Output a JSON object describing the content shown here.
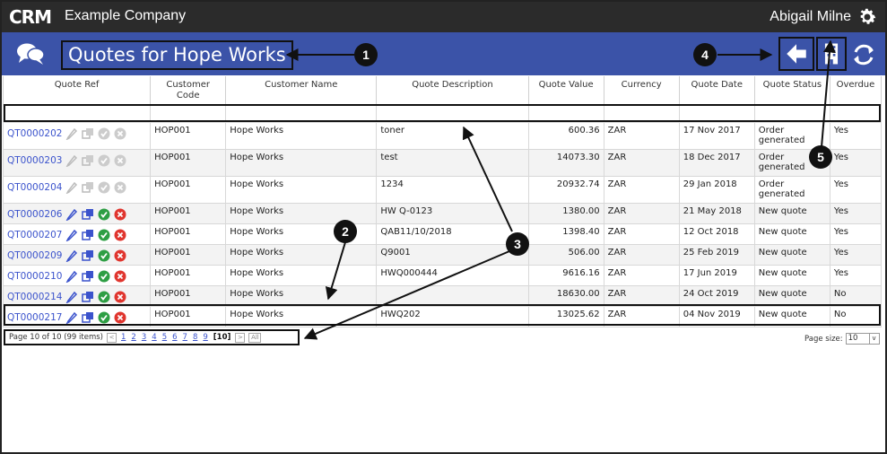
{
  "app": {
    "logo": "CRM",
    "company": "Example Company",
    "user": "Abigail Milne"
  },
  "header": {
    "title": "Quotes for Hope Works"
  },
  "icons": {
    "chat": "chat-bubbles-icon",
    "back": "arrow-left-icon",
    "company": "building-icon",
    "refresh": "refresh-icon",
    "settings": "gear-icon"
  },
  "colors": {
    "topbar": "#2b2b2b",
    "subbar": "#3b53a8",
    "link": "#3b53cc",
    "ok": "#2e9e44",
    "cancel": "#e0352e"
  },
  "columns": [
    "Quote Ref",
    "Customer Code",
    "Customer Name",
    "Quote Description",
    "Quote Value",
    "Currency",
    "Quote Date",
    "Quote Status",
    "Overdue"
  ],
  "rows": [
    {
      "ref": "QT0000202",
      "code": "HOP001",
      "name": "Hope Works",
      "desc": "toner",
      "value": "600.36",
      "currency": "ZAR",
      "date": "17 Nov 2017",
      "status": "Order generated",
      "overdue": "Yes"
    },
    {
      "ref": "QT0000203",
      "code": "HOP001",
      "name": "Hope Works",
      "desc": "test",
      "value": "14073.30",
      "currency": "ZAR",
      "date": "18 Dec 2017",
      "status": "Order generated",
      "overdue": "Yes"
    },
    {
      "ref": "QT0000204",
      "code": "HOP001",
      "name": "Hope Works",
      "desc": "1234",
      "value": "20932.74",
      "currency": "ZAR",
      "date": "29 Jan 2018",
      "status": "Order generated",
      "overdue": "Yes"
    },
    {
      "ref": "QT0000206",
      "code": "HOP001",
      "name": "Hope Works",
      "desc": "HW Q-0123",
      "value": "1380.00",
      "currency": "ZAR",
      "date": "21 May 2018",
      "status": "New quote",
      "overdue": "Yes"
    },
    {
      "ref": "QT0000207",
      "code": "HOP001",
      "name": "Hope Works",
      "desc": "QAB11/10/2018",
      "value": "1398.40",
      "currency": "ZAR",
      "date": "12 Oct 2018",
      "status": "New quote",
      "overdue": "Yes"
    },
    {
      "ref": "QT0000209",
      "code": "HOP001",
      "name": "Hope Works",
      "desc": "Q9001",
      "value": "506.00",
      "currency": "ZAR",
      "date": "25 Feb 2019",
      "status": "New quote",
      "overdue": "Yes"
    },
    {
      "ref": "QT0000210",
      "code": "HOP001",
      "name": "Hope Works",
      "desc": "HWQ000444",
      "value": "9616.16",
      "currency": "ZAR",
      "date": "17 Jun 2019",
      "status": "New quote",
      "overdue": "Yes"
    },
    {
      "ref": "QT0000214",
      "code": "HOP001",
      "name": "Hope Works",
      "desc": "",
      "value": "18630.00",
      "currency": "ZAR",
      "date": "24 Oct 2019",
      "status": "New quote",
      "overdue": "No"
    },
    {
      "ref": "QT0000217",
      "code": "HOP001",
      "name": "Hope Works",
      "desc": "HWQ202",
      "value": "13025.62",
      "currency": "ZAR",
      "date": "04 Nov 2019",
      "status": "New quote",
      "overdue": "No"
    }
  ],
  "pager": {
    "info": "Page 10 of 10 (99 items)",
    "pages": [
      "1",
      "2",
      "3",
      "4",
      "5",
      "6",
      "7",
      "8",
      "9"
    ],
    "current": "[10]",
    "prev": "<",
    "next": ">",
    "all": "All",
    "size_label": "Page size:",
    "size_value": "10",
    "size_dd": "v"
  },
  "callouts": [
    "1",
    "2",
    "3",
    "4",
    "5"
  ]
}
